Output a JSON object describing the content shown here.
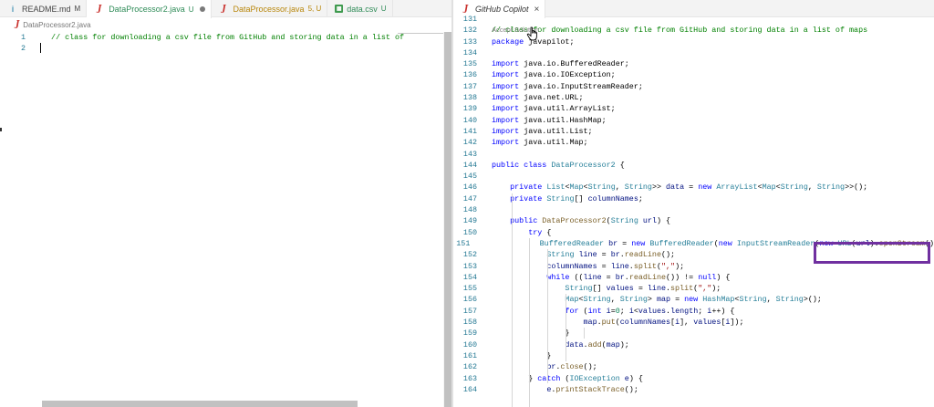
{
  "left_tabs": [
    {
      "icon": "i",
      "label": "README.md",
      "badge": "M",
      "status": "normal",
      "active": false
    },
    {
      "icon": "J",
      "label": "DataProcessor2.java",
      "badge": "U",
      "status": "untracked",
      "active": true,
      "dirty": true
    },
    {
      "icon": "J",
      "label": "DataProcessor.java",
      "badge": "5, U",
      "status": "mod",
      "active": false
    },
    {
      "icon": "▦",
      "label": "data.csv",
      "badge": "U",
      "status": "untracked",
      "active": false
    }
  ],
  "right_tab": {
    "icon": "J",
    "label": "GitHub Copilot",
    "close": "×"
  },
  "breadcrumb": {
    "icon": "J",
    "label": "DataProcessor2.java"
  },
  "left_editor": {
    "lines": [
      {
        "num": "1",
        "text": "  // class for downloading a csv file from GitHub and storing data in a list of"
      },
      {
        "num": "2",
        "text": ""
      }
    ]
  },
  "right_editor": {
    "accept_label": "Accept Solution",
    "lines": [
      {
        "num": "131",
        "html": ""
      },
      {
        "num": "132",
        "html": "<span class='cm'>// class for downloading a csv file from GitHub and storing data in a list of maps</span>"
      },
      {
        "num": "133",
        "html": "<span class='kw'>package</span> javapilot;"
      },
      {
        "num": "134",
        "html": ""
      },
      {
        "num": "135",
        "html": "<span class='kw'>import</span> java.io.BufferedReader;"
      },
      {
        "num": "136",
        "html": "<span class='kw'>import</span> java.io.IOException;"
      },
      {
        "num": "137",
        "html": "<span class='kw'>import</span> java.io.InputStreamReader;"
      },
      {
        "num": "138",
        "html": "<span class='kw'>import</span> java.net.URL;"
      },
      {
        "num": "139",
        "html": "<span class='kw'>import</span> java.util.ArrayList;"
      },
      {
        "num": "140",
        "html": "<span class='kw'>import</span> java.util.HashMap;"
      },
      {
        "num": "141",
        "html": "<span class='kw'>import</span> java.util.List;"
      },
      {
        "num": "142",
        "html": "<span class='kw'>import</span> java.util.Map;"
      },
      {
        "num": "143",
        "html": ""
      },
      {
        "num": "144",
        "html": "<span class='kw'>public class</span> <span class='ty'>DataProcessor2</span> {"
      },
      {
        "num": "145",
        "html": ""
      },
      {
        "num": "146",
        "html": "    <span class='kw'>private</span> <span class='ty'>List</span>&lt;<span class='ty'>Map</span>&lt;<span class='ty'>String</span>, <span class='ty'>String</span>&gt;&gt; <span class='vr'>data</span> = <span class='kw'>new</span> <span class='ty'>ArrayList</span>&lt;<span class='ty'>Map</span>&lt;<span class='ty'>String</span>, <span class='ty'>String</span>&gt;&gt;();"
      },
      {
        "num": "147",
        "html": "    <span class='kw'>private</span> <span class='ty'>String</span>[] <span class='vr'>columnNames</span>;"
      },
      {
        "num": "148",
        "html": ""
      },
      {
        "num": "149",
        "html": "    <span class='kw'>public</span> <span class='fn'>DataProcessor2</span>(<span class='ty'>String</span> <span class='vr'>url</span>) {"
      },
      {
        "num": "150",
        "html": "        <span class='kw'>try</span> {"
      },
      {
        "num": "151",
        "html": "            <span class='ty'>BufferedReader</span> <span class='vr'>br</span> = <span class='kw'>new</span> <span class='ty'>BufferedReader</span>(<span class='kw'>new</span> <span class='ty'>InputStreamReader</span>(<span class='kw'>new</span> <span class='ty'>URL</span>(<span class='vr'>url</span>).<span class='fn'>openStream</span>()"
      },
      {
        "num": "152",
        "html": "            <span class='ty'>String</span> <span class='vr'>line</span> = <span class='vr'>br</span>.<span class='fn'>readLine</span>();"
      },
      {
        "num": "153",
        "html": "            <span class='vr'>columnNames</span> = <span class='vr'>line</span>.<span class='fn'>split</span>(<span class='str'>\",\"</span>);"
      },
      {
        "num": "154",
        "html": "            <span class='kw'>while</span> ((<span class='vr'>line</span> = <span class='vr'>br</span>.<span class='fn'>readLine</span>()) != <span class='kw'>null</span>) {"
      },
      {
        "num": "155",
        "html": "                <span class='ty'>String</span>[] <span class='vr'>values</span> = <span class='vr'>line</span>.<span class='fn'>split</span>(<span class='str'>\",\"</span>);"
      },
      {
        "num": "156",
        "html": "                <span class='ty'>Map</span>&lt;<span class='ty'>String</span>, <span class='ty'>String</span>&gt; <span class='vr'>map</span> = <span class='kw'>new</span> <span class='ty'>HashMap</span>&lt;<span class='ty'>String</span>, <span class='ty'>String</span>&gt;();"
      },
      {
        "num": "157",
        "html": "                <span class='kw'>for</span> (<span class='kw'>int</span> <span class='vr'>i</span>=<span class='num'>0</span>; <span class='vr'>i</span>&lt;<span class='vr'>values</span>.<span class='vr'>length</span>; <span class='vr'>i</span>++) {"
      },
      {
        "num": "158",
        "html": "                    <span class='vr'>map</span>.<span class='fn'>put</span>(<span class='vr'>columnNames</span>[<span class='vr'>i</span>], <span class='vr'>values</span>[<span class='vr'>i</span>]);"
      },
      {
        "num": "159",
        "html": "                }"
      },
      {
        "num": "160",
        "html": "                <span class='vr'>data</span>.<span class='fn'>add</span>(<span class='vr'>map</span>);"
      },
      {
        "num": "161",
        "html": "            }"
      },
      {
        "num": "162",
        "html": "            <span class='vr'>br</span>.<span class='fn'>close</span>();"
      },
      {
        "num": "163",
        "html": "        } <span class='kw'>catch</span> (<span class='ty'>IOException</span> <span class='vr'>e</span>) {"
      },
      {
        "num": "164",
        "html": "            <span class='vr'>e</span>.<span class='fn'>printStackTrace</span>();"
      }
    ]
  },
  "colors": {
    "highlight_box": "#7030a0",
    "line_number": "#237893",
    "comment": "#008000",
    "keyword": "#0000ff",
    "type": "#267f99"
  }
}
